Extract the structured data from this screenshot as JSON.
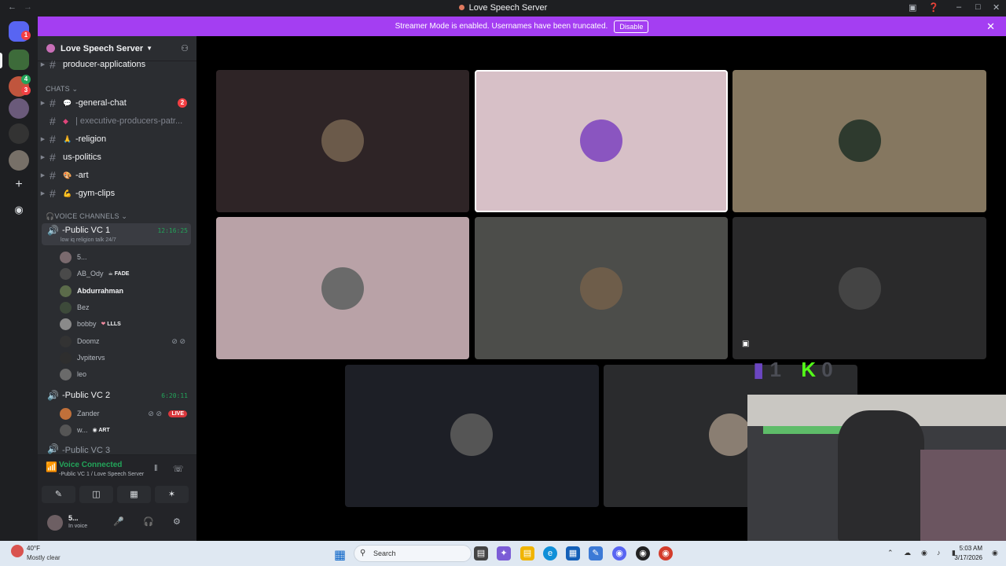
{
  "window": {
    "title": "Love Speech Server"
  },
  "banner": {
    "message": "Streamer Mode is enabled. Usernames have been truncated.",
    "disable_label": "Disable"
  },
  "rail": {
    "badges": [
      "1",
      "4",
      "3"
    ]
  },
  "server": {
    "name": "Love Speech Server"
  },
  "channels": {
    "top": "producer-applications",
    "category_chats": "CHATS",
    "items": [
      {
        "name": "-general-chat",
        "badge": "2"
      },
      {
        "name": "| executive-producers-patr..."
      },
      {
        "name": "-religion"
      },
      {
        "name": "us-politics"
      },
      {
        "name": "-art"
      },
      {
        "name": "-gym-clips"
      }
    ],
    "category_voice": "VOICE CHANNELS"
  },
  "voice": {
    "vc1": {
      "name": "-Public VC 1",
      "subtitle": "low iq religion talk 24/7",
      "timer": "12:16:25"
    },
    "vc1_members": [
      {
        "name": "5..."
      },
      {
        "name": "AB_Ody",
        "tag": "FADE"
      },
      {
        "name": "Abdurrahman"
      },
      {
        "name": "Bez"
      },
      {
        "name": "bobby",
        "tag": "LLLS"
      },
      {
        "name": "Doomz"
      },
      {
        "name": "Jvpitervs"
      },
      {
        "name": "leo"
      }
    ],
    "vc2": {
      "name": "-Public VC 2",
      "timer": "6:20:11"
    },
    "vc2_members": [
      {
        "name": "Zander",
        "live": "LIVE"
      },
      {
        "name": "w...",
        "tag": "ART"
      }
    ],
    "vc3": {
      "name": "-Public VC 3"
    }
  },
  "voice_panel": {
    "title": "Voice Connected",
    "subtitle": "-Public VC 1 / Love Speech Server"
  },
  "user_panel": {
    "name": "5...",
    "status": "In voice"
  },
  "overlay": {
    "twitch_count": "1",
    "kick_count": "0"
  },
  "colors": {
    "accent": "#a43ef2",
    "connected": "#23a55a",
    "sidebar": "#2b2d31",
    "rail": "#1e1f22"
  },
  "taskbar": {
    "temp": "40°F",
    "condition": "Mostly clear",
    "search_label": "Search",
    "time": "5:03 AM",
    "date": "3/17/2026"
  }
}
